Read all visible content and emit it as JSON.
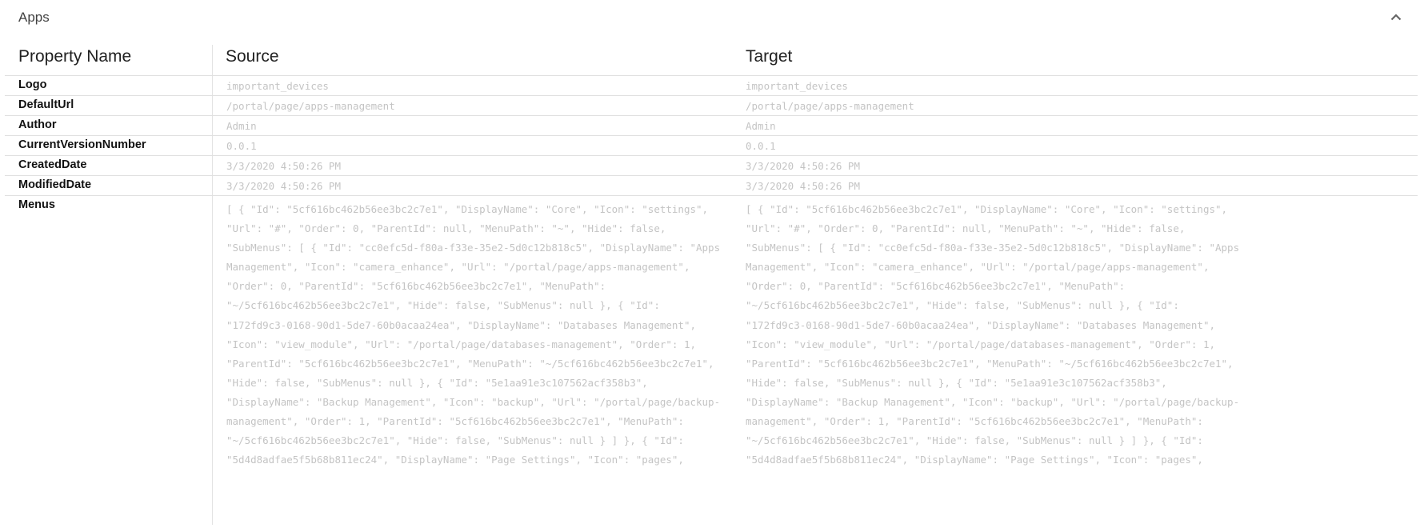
{
  "panel": {
    "title": "Apps",
    "collapse_icon": "chevron-up-icon"
  },
  "table": {
    "headers": {
      "property_name": "Property Name",
      "source": "Source",
      "target": "Target"
    },
    "rows": [
      {
        "name": "Logo",
        "source": "important_devices",
        "target": "important_devices"
      },
      {
        "name": "DefaultUrl",
        "source": "/portal/page/apps-management",
        "target": "/portal/page/apps-management"
      },
      {
        "name": "Author",
        "source": "Admin",
        "target": "Admin"
      },
      {
        "name": "CurrentVersionNumber",
        "source": "0.0.1",
        "target": "0.0.1"
      },
      {
        "name": "CreatedDate",
        "source": "3/3/2020 4:50:26 PM",
        "target": "3/3/2020 4:50:26 PM"
      },
      {
        "name": "ModifiedDate",
        "source": "3/3/2020 4:50:26 PM",
        "target": "3/3/2020 4:50:26 PM"
      },
      {
        "name": "Menus",
        "source": "[ { \"Id\": \"5cf616bc462b56ee3bc2c7e1\", \"DisplayName\": \"Core\", \"Icon\": \"settings\",\n\"Url\": \"#\", \"Order\": 0, \"ParentId\": null, \"MenuPath\": \"~\", \"Hide\": false,\n\"SubMenus\": [ { \"Id\": \"cc0efc5d-f80a-f33e-35e2-5d0c12b818c5\", \"DisplayName\": \"Apps\nManagement\", \"Icon\": \"camera_enhance\", \"Url\": \"/portal/page/apps-management\",\n\"Order\": 0, \"ParentId\": \"5cf616bc462b56ee3bc2c7e1\", \"MenuPath\":\n\"~/5cf616bc462b56ee3bc2c7e1\", \"Hide\": false, \"SubMenus\": null }, { \"Id\":\n\"172fd9c3-0168-90d1-5de7-60b0acaa24ea\", \"DisplayName\": \"Databases Management\",\n\"Icon\": \"view_module\", \"Url\": \"/portal/page/databases-management\", \"Order\": 1,\n\"ParentId\": \"5cf616bc462b56ee3bc2c7e1\", \"MenuPath\": \"~/5cf616bc462b56ee3bc2c7e1\",\n\"Hide\": false, \"SubMenus\": null }, { \"Id\": \"5e1aa91e3c107562acf358b3\",\n\"DisplayName\": \"Backup Management\", \"Icon\": \"backup\", \"Url\": \"/portal/page/backup-\nmanagement\", \"Order\": 1, \"ParentId\": \"5cf616bc462b56ee3bc2c7e1\", \"MenuPath\":\n\"~/5cf616bc462b56ee3bc2c7e1\", \"Hide\": false, \"SubMenus\": null } ] }, { \"Id\":\n\"5d4d8adfae5f5b68b811ec24\", \"DisplayName\": \"Page Settings\", \"Icon\": \"pages\",",
        "target": "[ { \"Id\": \"5cf616bc462b56ee3bc2c7e1\", \"DisplayName\": \"Core\", \"Icon\": \"settings\",\n\"Url\": \"#\", \"Order\": 0, \"ParentId\": null, \"MenuPath\": \"~\", \"Hide\": false,\n\"SubMenus\": [ { \"Id\": \"cc0efc5d-f80a-f33e-35e2-5d0c12b818c5\", \"DisplayName\": \"Apps\nManagement\", \"Icon\": \"camera_enhance\", \"Url\": \"/portal/page/apps-management\",\n\"Order\": 0, \"ParentId\": \"5cf616bc462b56ee3bc2c7e1\", \"MenuPath\":\n\"~/5cf616bc462b56ee3bc2c7e1\", \"Hide\": false, \"SubMenus\": null }, { \"Id\":\n\"172fd9c3-0168-90d1-5de7-60b0acaa24ea\", \"DisplayName\": \"Databases Management\",\n\"Icon\": \"view_module\", \"Url\": \"/portal/page/databases-management\", \"Order\": 1,\n\"ParentId\": \"5cf616bc462b56ee3bc2c7e1\", \"MenuPath\": \"~/5cf616bc462b56ee3bc2c7e1\",\n\"Hide\": false, \"SubMenus\": null }, { \"Id\": \"5e1aa91e3c107562acf358b3\",\n\"DisplayName\": \"Backup Management\", \"Icon\": \"backup\", \"Url\": \"/portal/page/backup-\nmanagement\", \"Order\": 1, \"ParentId\": \"5cf616bc462b56ee3bc2c7e1\", \"MenuPath\":\n\"~/5cf616bc462b56ee3bc2c7e1\", \"Hide\": false, \"SubMenus\": null } ] }, { \"Id\":\n\"5d4d8adfae5f5b68b811ec24\", \"DisplayName\": \"Page Settings\", \"Icon\": \"pages\","
      }
    ]
  },
  "colors": {
    "header_text": "#212121",
    "property_text": "#111111",
    "value_text": "#c4c4c4",
    "divider": "#e0e0e0",
    "icon": "#666666"
  }
}
